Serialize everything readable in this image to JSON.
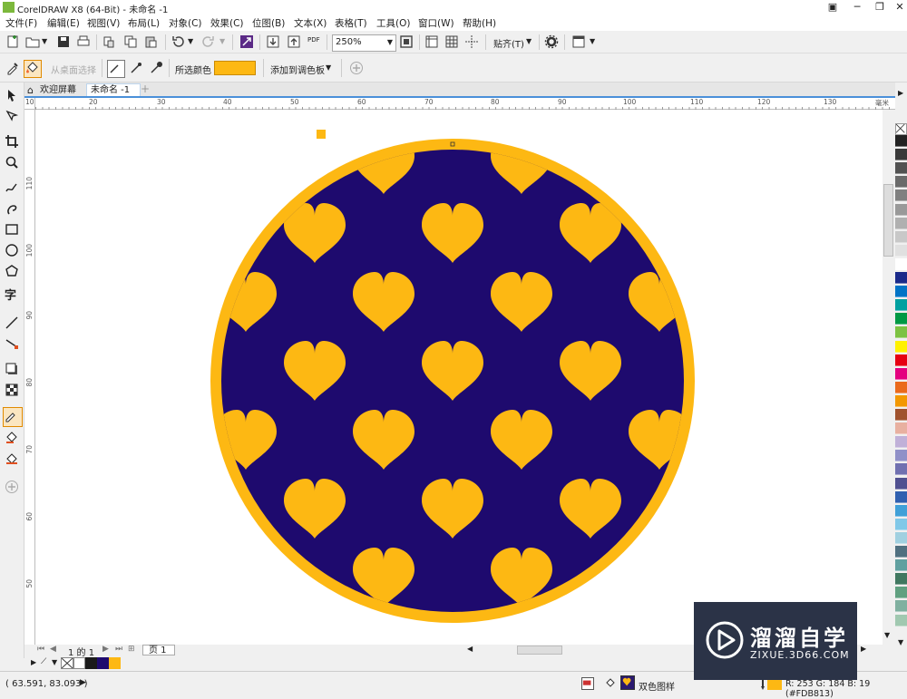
{
  "window": {
    "title": "CorelDRAW X8 (64-Bit) - 未命名 -1",
    "buttons": [
      "▣",
      "─",
      "❐",
      "✕"
    ]
  },
  "menu": [
    "文件(F)",
    "编辑(E)",
    "视图(V)",
    "布局(L)",
    "对象(C)",
    "效果(C)",
    "位图(B)",
    "文本(X)",
    "表格(T)",
    "工具(O)",
    "窗口(W)",
    "帮助(H)"
  ],
  "toolbar": {
    "pdf_label": "PDF",
    "zoom_value": "250%",
    "snap_label": "贴齐(T)"
  },
  "property_bar": {
    "from_desktop_label": "从桌面选择",
    "selected_color_label": "所选颜色",
    "selected_color": "#FDB813",
    "add_to_palette_label": "添加到调色板"
  },
  "tabs": {
    "home_label": "欢迎屏幕",
    "doc_label": "未命名 -1"
  },
  "rulers": {
    "unit": "毫米",
    "h_ticks": [
      "10",
      "20",
      "30",
      "40",
      "50",
      "60",
      "70",
      "80",
      "90",
      "100",
      "110",
      "120",
      "130"
    ],
    "v_ticks": [
      "110",
      "100",
      "90",
      "80",
      "70",
      "60",
      "50"
    ]
  },
  "colors": {
    "navy": "#1E0A6E",
    "orange": "#FDB813"
  },
  "page_nav": {
    "page_text": "1 的 1",
    "page_tab": "页 1"
  },
  "status": {
    "coords": "( 63.591, 83.093 )",
    "fill_name": "双色图样",
    "color_info": "R: 253 G: 184 B: 19 (#FDB813)"
  },
  "watermark": {
    "cn": "溜溜自学",
    "en": "ZIXUE.3D66.COM"
  },
  "palette": [
    "#222222",
    "#3a3a3a",
    "#525252",
    "#6a6a6a",
    "#808080",
    "#999999",
    "#b0b0b0",
    "#c8c8c8",
    "#e0e0e0",
    "#ffffff",
    "#1a2a8a",
    "#0073c6",
    "#00a0a0",
    "#009944",
    "#7dc242",
    "#fff100",
    "#e60012",
    "#e4007f",
    "#ea6a1c",
    "#f39800",
    "#a0522d",
    "#e8b0a0",
    "#c0b0d8",
    "#9090c8",
    "#7070b0",
    "#505090",
    "#3060b0",
    "#40a0d8",
    "#80c8e8",
    "#a0d0e0",
    "#507080",
    "#60a0a0",
    "#407860",
    "#60a080",
    "#80b0a0",
    "#a0c8b0"
  ]
}
